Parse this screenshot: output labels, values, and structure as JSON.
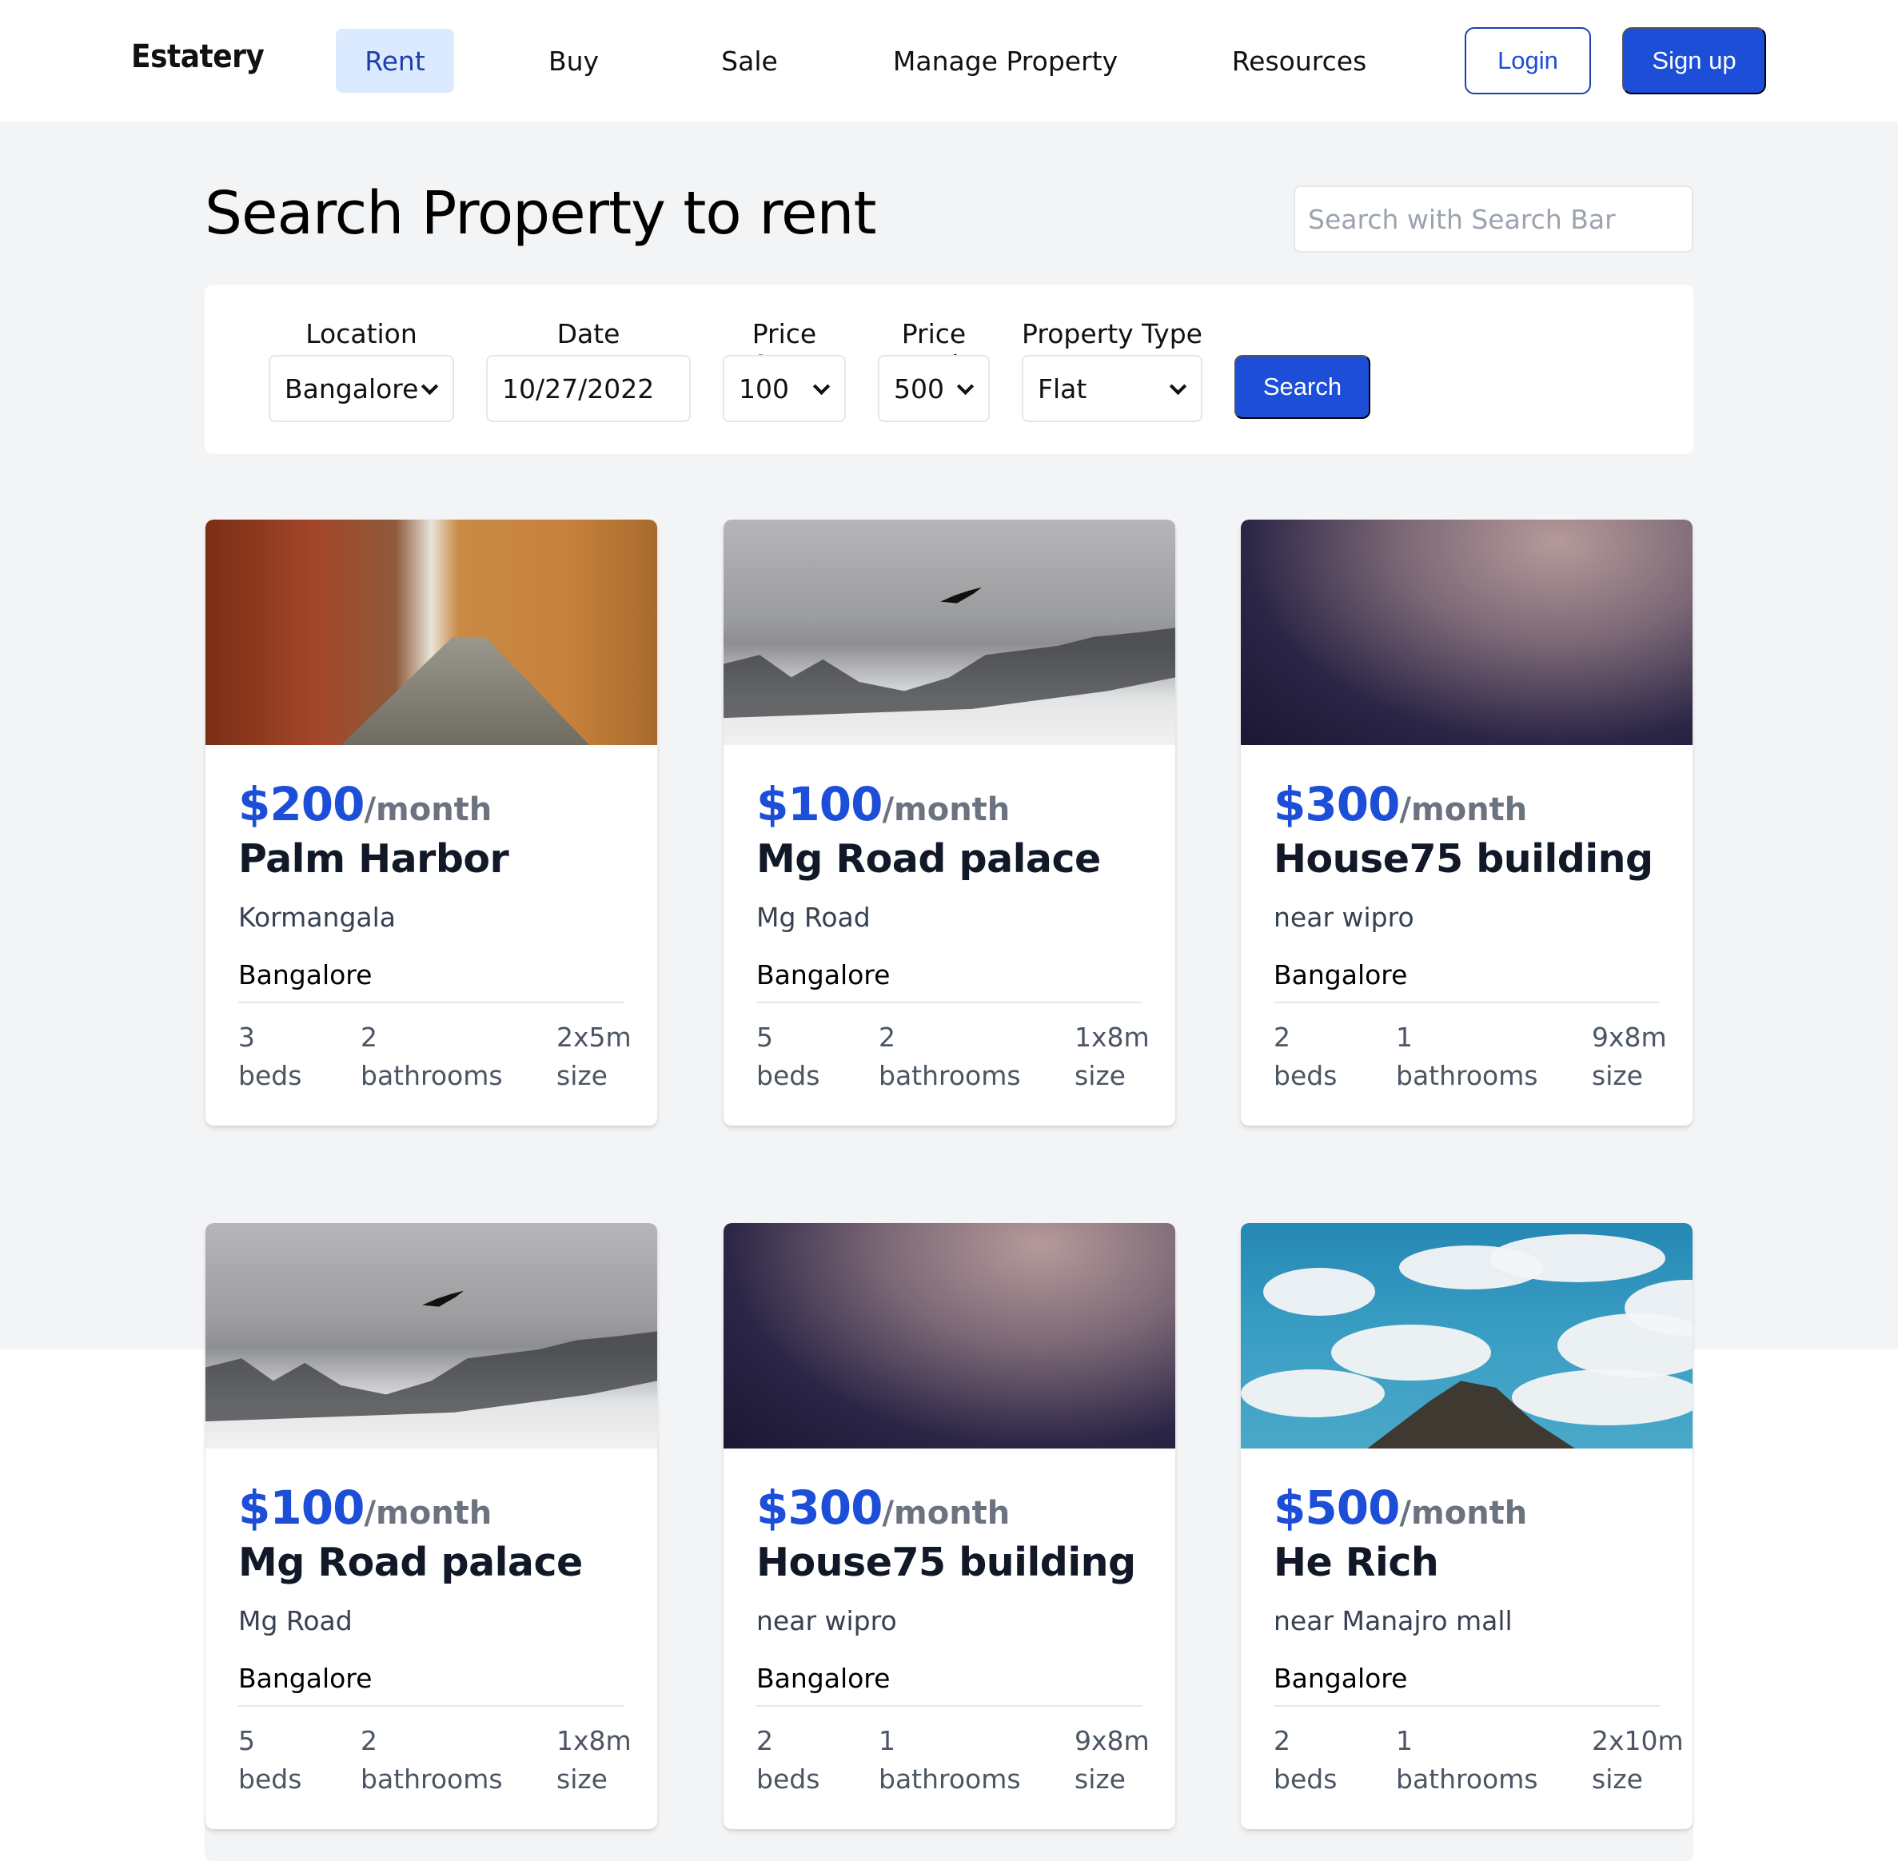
{
  "brand": "Estatery",
  "nav": {
    "links": [
      {
        "label": "Rent",
        "active": true
      },
      {
        "label": "Buy",
        "active": false
      },
      {
        "label": "Sale",
        "active": false
      },
      {
        "label": "Manage Property",
        "active": false
      },
      {
        "label": "Resources",
        "active": false
      }
    ],
    "login_label": "Login",
    "signup_label": "Sign up"
  },
  "header": {
    "title": "Search Property to rent",
    "search_placeholder": "Search with Search Bar"
  },
  "filters": {
    "location": {
      "label": "Location",
      "value": "Bangalore"
    },
    "date": {
      "label": "Date",
      "value": "10/27/2022"
    },
    "price_start": {
      "label": "Price Start",
      "value": "100"
    },
    "price_end": {
      "label": "Price End",
      "value": "500"
    },
    "property_type": {
      "label": "Property Type",
      "value": "Flat"
    },
    "search_label": "Search"
  },
  "colors": {
    "accent": "#1d4ed8",
    "nav_active_bg": "#dbeafe",
    "page_bg": "#f3f4f6"
  },
  "listings": [
    {
      "price": "$200",
      "period": "/month",
      "name": "Palm Harbor",
      "area": "Kormangala",
      "city": "Bangalore",
      "beds": "3",
      "beds_label": "beds",
      "baths": "2",
      "baths_label": "bathrooms",
      "size": "2x5m",
      "size_label": "size",
      "image": "alley"
    },
    {
      "price": "$100",
      "period": "/month",
      "name": "Mg Road palace",
      "area": "Mg Road",
      "city": "Bangalore",
      "beds": "5",
      "beds_label": "beds",
      "baths": "2",
      "baths_label": "bathrooms",
      "size": "1x8m",
      "size_label": "size",
      "image": "mountain"
    },
    {
      "price": "$300",
      "period": "/month",
      "name": "House75 building",
      "area": "near wipro",
      "city": "Bangalore",
      "beds": "2",
      "beds_label": "beds",
      "baths": "1",
      "baths_label": "bathrooms",
      "size": "9x8m",
      "size_label": "size",
      "image": "night-sky"
    },
    {
      "price": "$100",
      "period": "/month",
      "name": "Mg Road palace",
      "area": "Mg Road",
      "city": "Bangalore",
      "beds": "5",
      "beds_label": "beds",
      "baths": "2",
      "baths_label": "bathrooms",
      "size": "1x8m",
      "size_label": "size",
      "image": "mountain"
    },
    {
      "price": "$300",
      "period": "/month",
      "name": "House75 building",
      "area": "near wipro",
      "city": "Bangalore",
      "beds": "2",
      "beds_label": "beds",
      "baths": "1",
      "baths_label": "bathrooms",
      "size": "9x8m",
      "size_label": "size",
      "image": "night-sky"
    },
    {
      "price": "$500",
      "period": "/month",
      "name": "He Rich",
      "area": "near Manajro mall",
      "city": "Bangalore",
      "beds": "2",
      "beds_label": "beds",
      "baths": "1",
      "baths_label": "bathrooms",
      "size": "2x10m",
      "size_label": "size",
      "image": "clouds"
    }
  ]
}
